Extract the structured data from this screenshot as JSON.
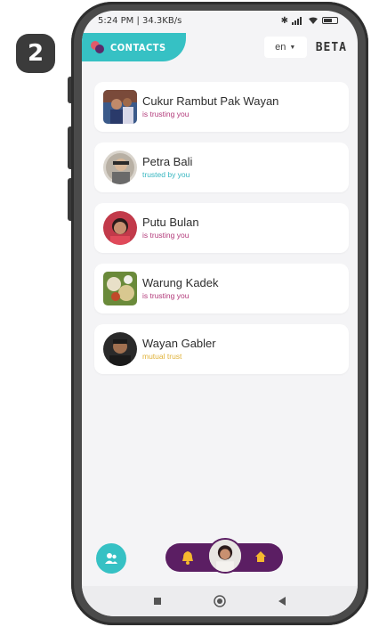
{
  "step": "2",
  "status_bar": {
    "time_speed": "5:24 PM | 34.3KB/s"
  },
  "header": {
    "tab_title": "CONTACTS",
    "language": "en",
    "beta_label": "BETA"
  },
  "colors": {
    "teal": "#36c1c4",
    "purple": "#5b1e63",
    "status_trusting": "#b23a7a",
    "status_trusted_by": "#36b6c0",
    "status_mutual": "#e0b23a"
  },
  "contacts": [
    {
      "name": "Cukur Rambut Pak Wayan",
      "status": "is trusting you",
      "status_color": "#b23a7a"
    },
    {
      "name": "Petra Bali",
      "status": "trusted by you",
      "status_color": "#36b6c0"
    },
    {
      "name": "Putu Bulan",
      "status": "is trusting you",
      "status_color": "#b23a7a"
    },
    {
      "name": "Warung Kadek",
      "status": "is trusting you",
      "status_color": "#b23a7a"
    },
    {
      "name": "Wayan Gabler",
      "status": "mutual trust",
      "status_color": "#e0b23a"
    }
  ],
  "icons": {
    "fab": "people-icon",
    "notifications": "bell-icon",
    "home": "home-icon"
  }
}
